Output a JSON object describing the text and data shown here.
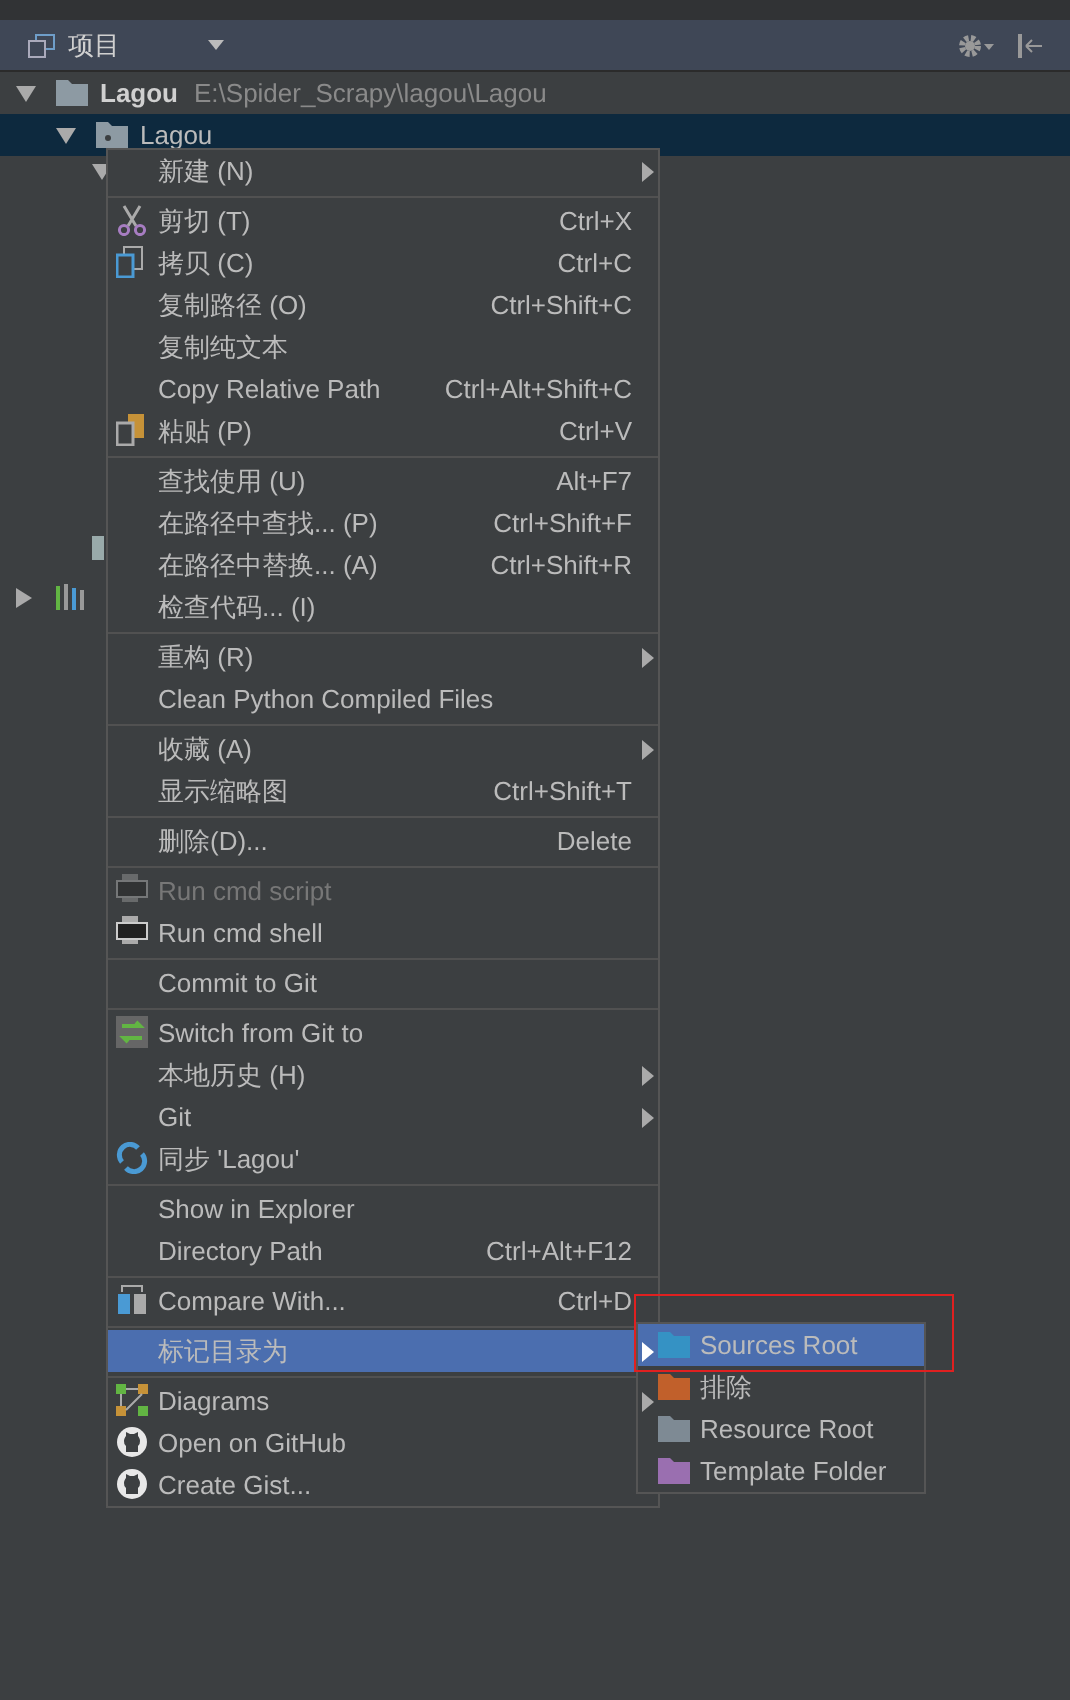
{
  "panel": {
    "title": "项目"
  },
  "tree": [
    {
      "kind": "folder",
      "label": "Lagou",
      "path": "E:\\Spider_Scrapy\\lagou\\Lagou",
      "expanded": true,
      "selected": false,
      "children": [
        {
          "kind": "module",
          "label": "Lagou",
          "expanded": true,
          "selected": true
        }
      ]
    },
    {
      "kind": "library",
      "expanded": false,
      "selected": false
    }
  ],
  "menu": {
    "groups": [
      [
        {
          "label": "新建 (N)",
          "submenu": true
        }
      ],
      [
        {
          "label": "剪切 (T)",
          "shortcut": "Ctrl+X",
          "kind": "scissors"
        },
        {
          "label": "拷贝 (C)",
          "shortcut": "Ctrl+C",
          "kind": "copy"
        },
        {
          "label": "复制路径 (O)",
          "shortcut": "Ctrl+Shift+C"
        },
        {
          "label": "复制纯文本"
        },
        {
          "label": "Copy Relative Path",
          "shortcut": "Ctrl+Alt+Shift+C"
        },
        {
          "label": "粘贴 (P)",
          "shortcut": "Ctrl+V",
          "kind": "paste"
        }
      ],
      [
        {
          "label": "查找使用 (U)",
          "shortcut": "Alt+F7"
        },
        {
          "label": "在路径中查找... (P)",
          "shortcut": "Ctrl+Shift+F"
        },
        {
          "label": "在路径中替换... (A)",
          "shortcut": "Ctrl+Shift+R"
        },
        {
          "label": "检查代码... (I)"
        }
      ],
      [
        {
          "label": "重构 (R)",
          "submenu": true
        },
        {
          "label": "Clean Python Compiled Files"
        }
      ],
      [
        {
          "label": "收藏 (A)",
          "submenu": true
        },
        {
          "label": "显示缩略图",
          "shortcut": "Ctrl+Shift+T"
        }
      ],
      [
        {
          "label": "删除(D)...",
          "shortcut": "Delete"
        }
      ],
      [
        {
          "label": "Run cmd script",
          "kind": "cmd",
          "disabled": true
        },
        {
          "label": "Run cmd shell",
          "kind": "cmd",
          "disabled": false
        }
      ],
      [
        {
          "label": "Commit to Git"
        }
      ],
      [
        {
          "label": "Switch from Git to",
          "kind": "switch"
        },
        {
          "label": "本地历史 (H)",
          "submenu": true
        },
        {
          "label": "Git",
          "submenu": true
        },
        {
          "label": "同步 'Lagou'",
          "kind": "sync"
        }
      ],
      [
        {
          "label": "Show in Explorer"
        },
        {
          "label": "Directory Path",
          "shortcut": "Ctrl+Alt+F12"
        }
      ],
      [
        {
          "label": "Compare With...",
          "shortcut": "Ctrl+D",
          "kind": "compare"
        }
      ],
      [
        {
          "label": "标记目录为",
          "submenu": true,
          "selected": true
        }
      ],
      [
        {
          "label": "Diagrams",
          "submenu": true,
          "kind": "diagram"
        },
        {
          "label": "Open on GitHub",
          "kind": "github"
        },
        {
          "label": "Create Gist...",
          "kind": "github"
        }
      ]
    ]
  },
  "submenu": [
    {
      "label": "Sources Root",
      "color": "#3592c4",
      "selected": true
    },
    {
      "label": "排除",
      "color": "#c1602b",
      "selected": false
    },
    {
      "label": "Resource Root",
      "color": "#7e8a94",
      "selected": false
    },
    {
      "label": "Template Folder",
      "color": "#9a6fb0",
      "selected": false
    }
  ]
}
